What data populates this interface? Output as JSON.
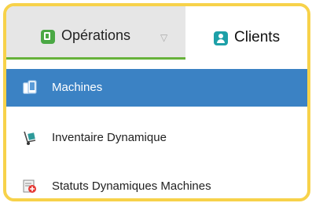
{
  "tabs": {
    "operations": {
      "label": "Opérations",
      "icon": "clipboard-icon",
      "caret": "▽",
      "active": true
    },
    "clients": {
      "label": "Clients",
      "icon": "user-icon"
    }
  },
  "menu": {
    "items": [
      {
        "label": "Machines",
        "icon": "devices-icon",
        "selected": true
      },
      {
        "label": "Inventaire Dynamique",
        "icon": "hand-truck-icon"
      },
      {
        "label": "Statuts Dynamiques Machines",
        "icon": "status-report-icon"
      }
    ]
  },
  "colors": {
    "frame_border": "#f7d24a",
    "selected_background": "#3b82c4",
    "active_tab_underline": "#67b23a",
    "operations_icon": "#4aa844",
    "clients_icon": "#1da0a8"
  }
}
